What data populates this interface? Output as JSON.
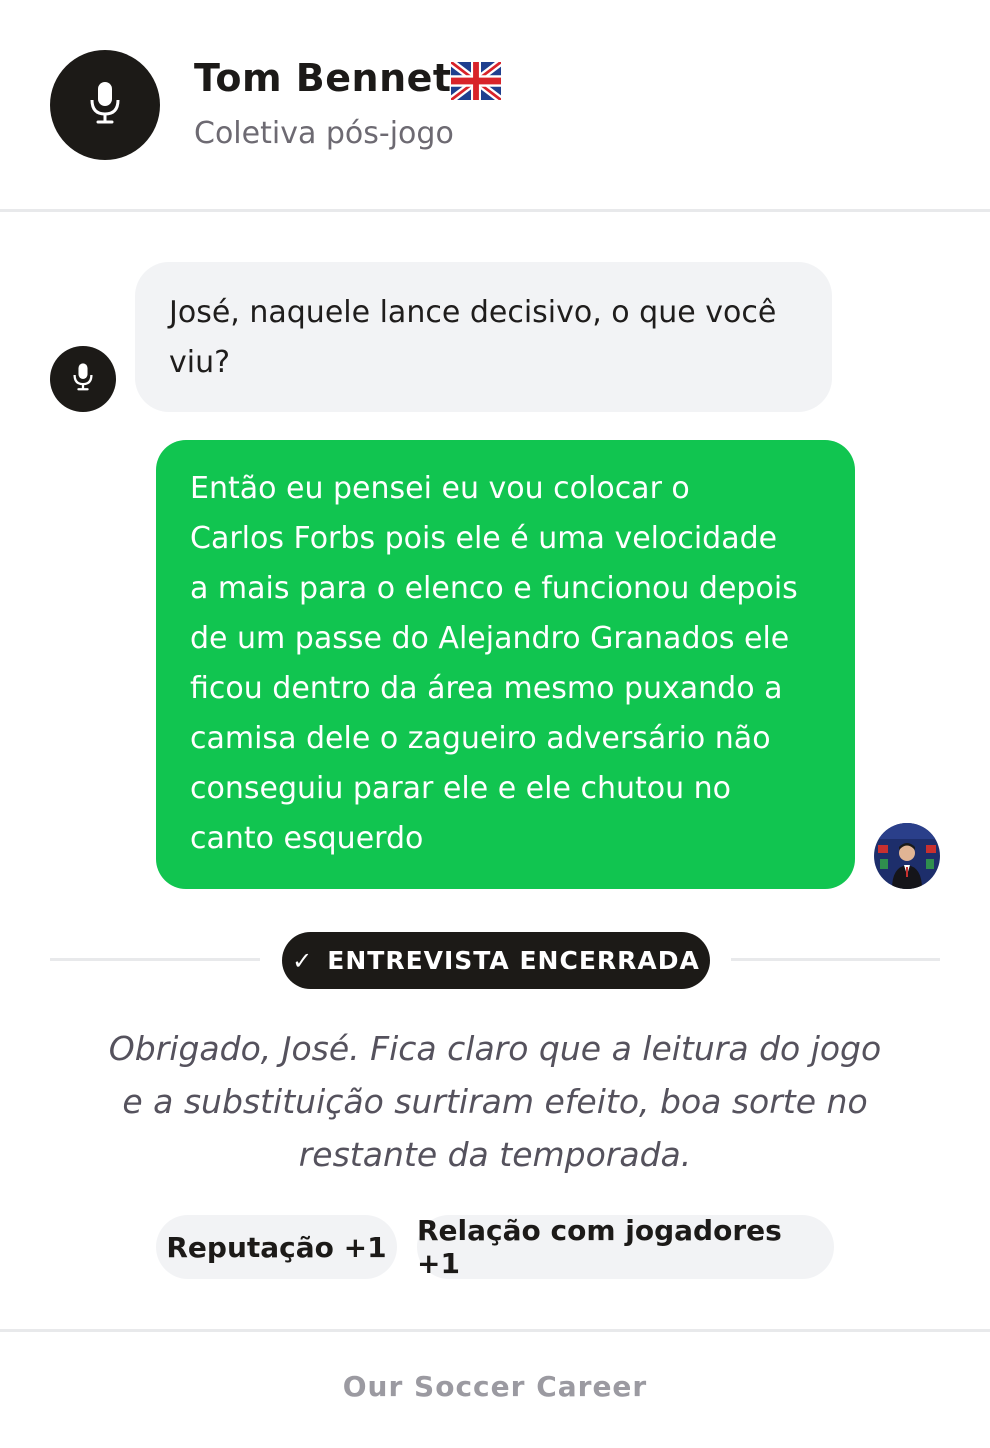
{
  "header": {
    "name": "Tom Bennett",
    "flag_icon": "uk-flag-icon",
    "subtitle": "Coletiva pós-jogo",
    "avatar_icon": "microphone-icon"
  },
  "messages": [
    {
      "role": "reporter",
      "avatar_icon": "microphone-icon",
      "text": "José, naquele lance decisivo, o que você viu?"
    },
    {
      "role": "player",
      "avatar": "user-avatar",
      "lines": [
        "Então eu pensei eu vou colocar o",
        "Carlos Forbs pois ele é uma velocidade",
        "a mais para o elenco e funcionou depois",
        "de um passe do Alejandro Granados ele",
        "ficou dentro da área mesmo puxando a",
        "camisa dele o zagueiro adversário não",
        "conseguiu parar ele e ele chutou no",
        "canto esquerdo"
      ]
    }
  ],
  "status": {
    "check_icon": "check-icon",
    "label": "ENTREVISTA ENCERRADA"
  },
  "closing": {
    "lines": [
      "Obrigado, José. Fica claro que a leitura do jogo",
      "e a substituição surtiram efeito, boa sorte no",
      "restante da temporada."
    ]
  },
  "effects": [
    {
      "label": "Reputação +1"
    },
    {
      "label": "Relação com jogadores +1"
    }
  ],
  "footer": {
    "brand": "Our Soccer Career"
  },
  "colors": {
    "accent_green": "#11c550",
    "dark": "#1c1a17",
    "bubble_gray": "#f2f3f5",
    "muted_text": "#6d6a72"
  }
}
